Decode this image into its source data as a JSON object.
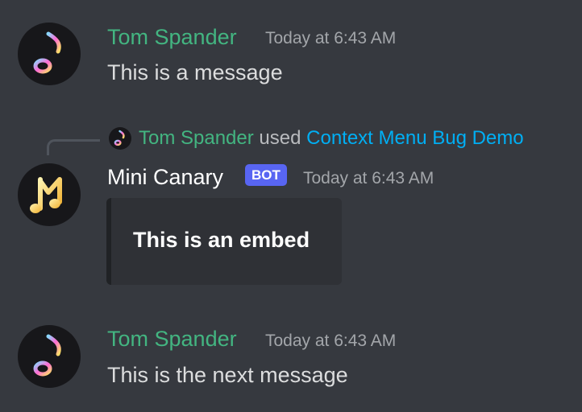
{
  "colors": {
    "background": "#36393f",
    "user_name_color": "#43b581",
    "reply_name_color": "#43b581",
    "command_link_color": "#00aff4",
    "bot_name_color": "#ffffff",
    "bot_tag_bg": "#5865f2",
    "embed_bg": "#2f3136",
    "text": "#dcddde",
    "timestamp": "#a3a6aa"
  },
  "messages": [
    {
      "author": "Tom Spander",
      "timestamp": "Today at 6:43 AM",
      "content": "This is a message",
      "avatar_icon": "music-note-icon"
    },
    {
      "reply": {
        "user": "Tom Spander",
        "used_text": "used",
        "command": "Context Menu Bug Demo",
        "avatar_icon": "music-note-icon"
      },
      "author": "Mini Canary",
      "bot_tag": "BOT",
      "timestamp": "Today at 6:43 AM",
      "avatar_icon": "music-glyph-icon",
      "embed": {
        "title": "This is an embed"
      }
    },
    {
      "author": "Tom Spander",
      "timestamp": "Today at 6:43 AM",
      "content": "This is the next message",
      "avatar_icon": "music-note-icon"
    }
  ]
}
